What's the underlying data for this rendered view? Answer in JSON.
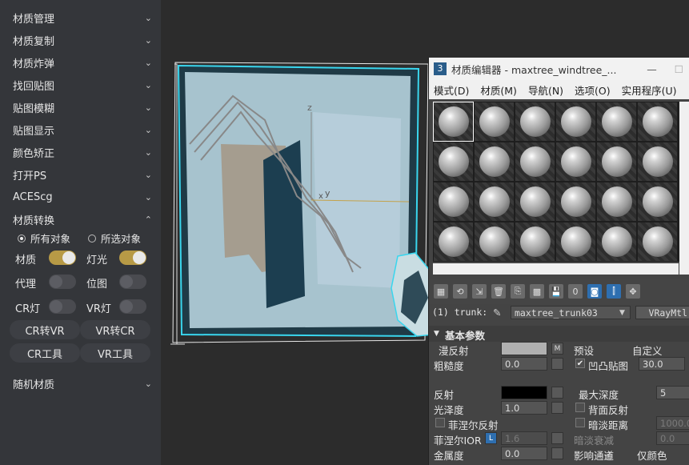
{
  "left_panel": {
    "sections": [
      "材质管理",
      "材质复制",
      "材质炸弹",
      "找回贴图",
      "贴图模糊",
      "贴图显示",
      "颜色矫正",
      "打开PS",
      "ACEScg",
      "材质转换"
    ],
    "random_section": "随机材质",
    "radio_all": "所有对象",
    "radio_selected": "所选对象",
    "toggles": {
      "material": "材质",
      "light": "灯光",
      "proxy": "代理",
      "bitmap": "位图",
      "cr_light": "CR灯",
      "vr_light": "VR灯"
    },
    "buttons": [
      "CR转VR",
      "VR转CR",
      "CR工具",
      "VR工具"
    ],
    "accent": "#b79a46"
  },
  "viewport": {
    "axis_z": "z",
    "axis_y": "y",
    "axis_x": "x"
  },
  "material_editor": {
    "title": "材质编辑器 - maxtree_windtree_...",
    "menus": [
      "模式(D)",
      "材质(M)",
      "导航(N)",
      "选项(O)",
      "实用程序(U)"
    ],
    "slot_label": "(1) trunk:",
    "material_name": "maxtree_trunk03",
    "material_type": "VRayMtl",
    "rollout_title": "基本参数",
    "diffuse_label": "漫反射",
    "m_label": "M",
    "preset_label": "预设",
    "preset_value": "自定义",
    "roughness_label": "粗糙度",
    "roughness_value": "0.0",
    "bump_label": "凹凸贴图",
    "bump_value": "30.0",
    "reflect_label": "反射",
    "max_depth_label": "最大深度",
    "max_depth_value": "5",
    "gloss_label": "光泽度",
    "gloss_value": "1.0",
    "back_reflect_label": "背面反射",
    "fresnel_label": "菲涅尔反射",
    "dim_dist_label": "暗淡距离",
    "dim_dist_value": "1000.0",
    "fresnel_ior_label": "菲涅尔IOR",
    "l_label": "L",
    "fresnel_ior_value": "1.6",
    "dim_falloff_label": "暗淡衰减",
    "dim_falloff_value": "0.0",
    "metal_label": "金属度",
    "metal_value": "0.0",
    "affect_label": "影响通道",
    "color_only_label": "仅颜色"
  }
}
